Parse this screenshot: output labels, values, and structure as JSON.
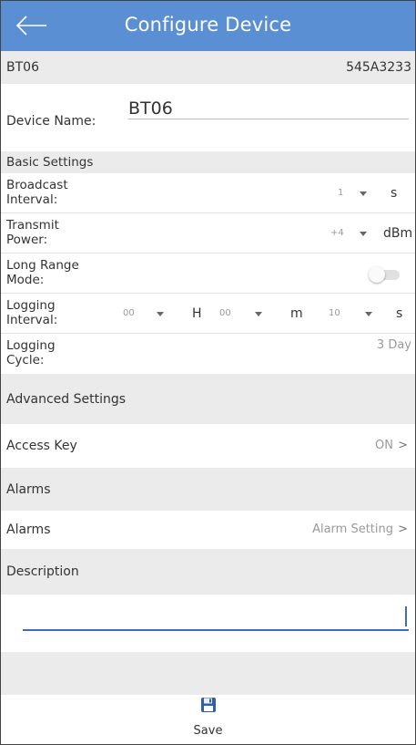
{
  "header": {
    "title": "Configure Device",
    "back_icon": "arrow-left-icon",
    "color": "#5b8fd3"
  },
  "device": {
    "id_left": "BT06",
    "id_right": "545A3233"
  },
  "device_name": {
    "label": "Device Name:",
    "value": "BT06"
  },
  "sections": {
    "basic": "Basic Settings",
    "advanced": "Advanced Settings",
    "alarms": "Alarms",
    "description": "Description"
  },
  "broadcast_interval": {
    "label_line1": "Broadcast",
    "label_line2": "Interval:",
    "value": "1",
    "unit": "s"
  },
  "transmit_power": {
    "label_line1": "Transmit",
    "label_line2": "Power:",
    "value": "+4",
    "unit": "dBm"
  },
  "long_range_mode": {
    "label_line1": "Long Range",
    "label_line2": "Mode:",
    "enabled": false
  },
  "logging_interval": {
    "label_line1": "Logging",
    "label_line2": "Interval:",
    "hours": "00",
    "hours_unit": "H",
    "minutes": "00",
    "minutes_unit": "m",
    "seconds": "10",
    "seconds_unit": "s"
  },
  "logging_cycle": {
    "label_line1": "Logging",
    "label_line2": "Cycle:",
    "value": "3 Day"
  },
  "access_key": {
    "label": "Access Key",
    "value": "ON",
    "chevron": ">"
  },
  "alarms_row": {
    "label": "Alarms",
    "value": "Alarm Setting",
    "chevron": ">"
  },
  "description": {
    "value": ""
  },
  "footer": {
    "save_label": "Save",
    "save_icon": "floppy-disk-icon"
  }
}
